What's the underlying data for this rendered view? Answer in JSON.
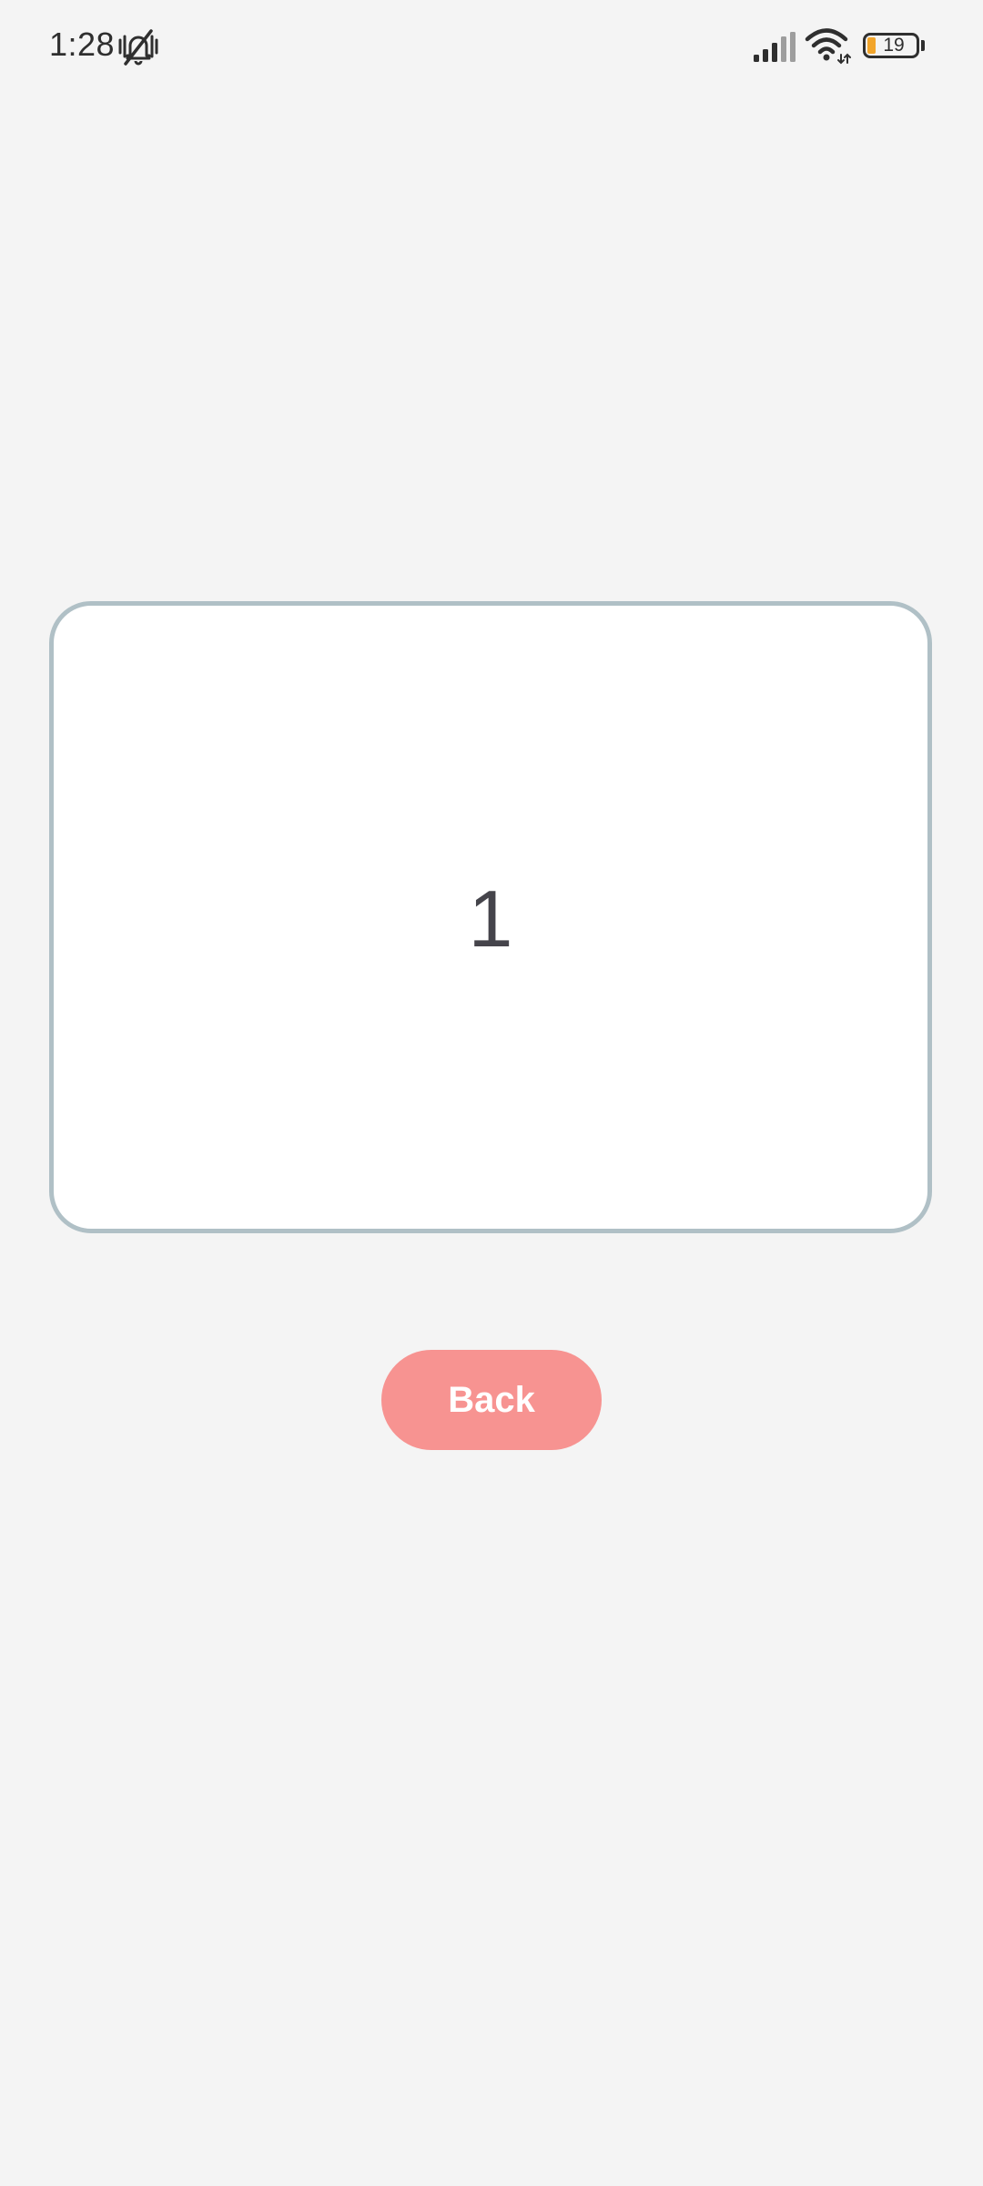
{
  "status_bar": {
    "time": "1:28",
    "battery_level": "19",
    "icons": {
      "mute": "bell-off-vibrate-icon",
      "signal": "cellular-signal-icon",
      "wifi": "wifi-icon",
      "battery": "battery-icon"
    },
    "battery_fill_color": "#f2a52b"
  },
  "card": {
    "value": "1",
    "border_color": "#b0c0c6",
    "background": "#ffffff"
  },
  "back_button": {
    "label": "Back",
    "color": "#f79391"
  }
}
